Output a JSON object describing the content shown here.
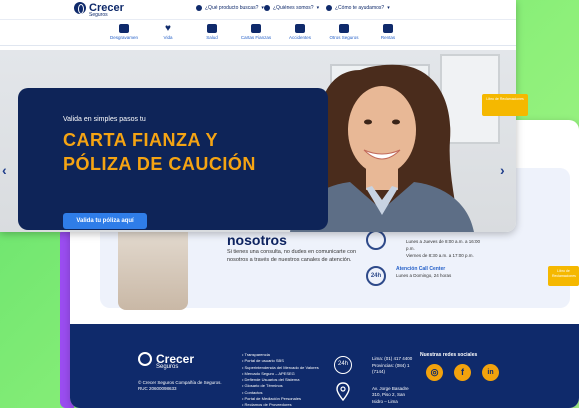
{
  "colors": {
    "navy": "#0f2a6b",
    "accent": "#f5a413",
    "blue": "#2f7de8",
    "green_bg": "#7ee35c"
  },
  "header": {
    "brand": "Crecer",
    "brand_sub": "Seguros",
    "menus": [
      {
        "label": "¿Qué producto buscas?",
        "icon": "search-icon"
      },
      {
        "label": "¿Quiénes somos?",
        "icon": "people-icon"
      },
      {
        "label": "¿Cómo te ayudamos?",
        "icon": "help-icon"
      }
    ],
    "nav_items": [
      {
        "label": "Desgravamen",
        "icon": "shield-icon"
      },
      {
        "label": "Vida",
        "icon": "heart-icon"
      },
      {
        "label": "Salud",
        "icon": "health-icon"
      },
      {
        "label": "Cartas Fianzas",
        "icon": "building-icon"
      },
      {
        "label": "Accidentes",
        "icon": "accident-icon"
      },
      {
        "label": "Otros Seguros",
        "icon": "umbrella-icon"
      },
      {
        "label": "Rentas",
        "icon": "money-icon"
      }
    ]
  },
  "hero": {
    "subtitle": "Valida en simples pasos tu",
    "title": "CARTA FIANZA Y PÓLIZA DE CAUCIÓN",
    "button": "Valida tu póliza aquí",
    "badge": "Libro de Reclamaciones"
  },
  "contact": {
    "title": "nosotros",
    "text": "Si tienes una consulta, no dudes en comunicarte con nosotros a través de nuestros canales de atención.",
    "hours_line1": "Lunes a Jueves de 8:00 a.m. a 16:00 p.m.",
    "hours_line2": "Viernes de 8:30 a.m. a 17:00 p.m.",
    "call_title": "Atención Call Center",
    "call_sub": "Lunes a Domingo, 24 horas",
    "side_badge": "Libro de Reclamaciones"
  },
  "footer": {
    "brand": "Crecer",
    "brand_sub": "Seguros",
    "copy": "© Crecer Seguros Compañía de Seguros. RUC 20600098633",
    "links": [
      "Transparencia",
      "Portal de usuario SBS",
      "Superintendencia del Mercado de Valores",
      "Mercado Seguro – APESEG",
      "Defiende Usuarios del Sistema",
      "Glosario de Términos",
      "Contactos",
      "Portal de Mediación Personales",
      "Reclamos de Proveedores",
      "Consulta aquí los servicios del Seguro de..."
    ],
    "phone": "Lima: (01) 417 4400",
    "phone2": "Provincias: (084) 1 (7144)",
    "address": "Av. Jorge Basadre 310, Piso 2, San Isidro – Lima",
    "social_title": "Nuestras redes sociales",
    "social": [
      {
        "name": "instagram-icon",
        "glyph": "◎"
      },
      {
        "name": "facebook-icon",
        "glyph": "f"
      },
      {
        "name": "linkedin-icon",
        "glyph": "in"
      }
    ]
  }
}
